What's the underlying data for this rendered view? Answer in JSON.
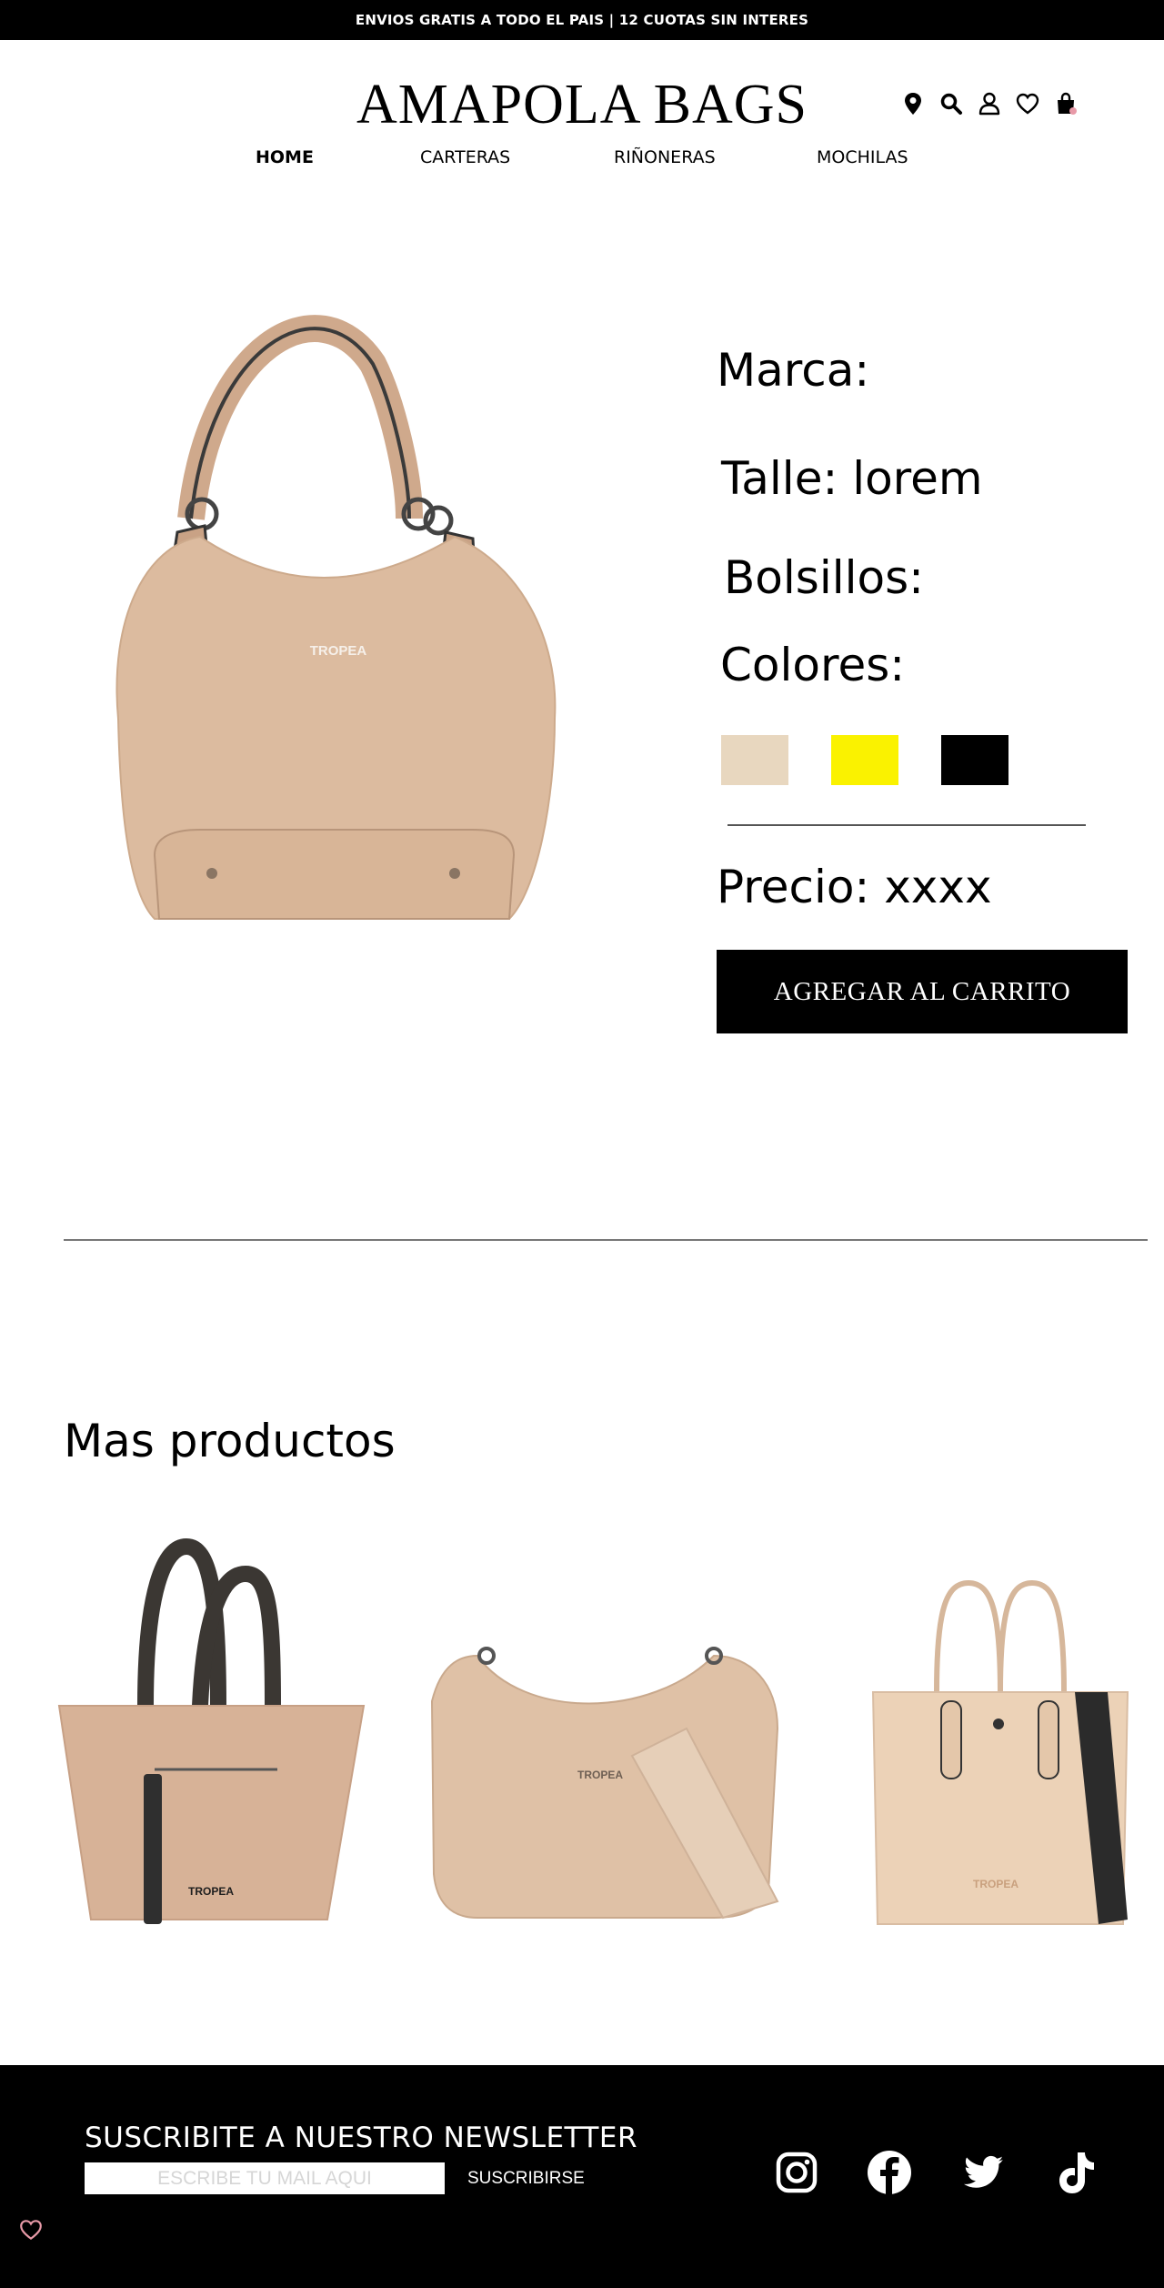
{
  "topbar": {
    "text": "ENVIOS GRATIS A TODO EL PAIS | 12 CUOTAS SIN INTERES"
  },
  "brand": {
    "logo_text": "AMAPOLA BAGS"
  },
  "header_icons": [
    "location-icon",
    "search-icon",
    "user-icon",
    "heart-icon",
    "shopping-bag-icon"
  ],
  "nav": {
    "items": [
      {
        "label": "HOME",
        "active": true
      },
      {
        "label": "CARTERAS",
        "active": false
      },
      {
        "label": "RIÑONERAS",
        "active": false
      },
      {
        "label": "MOCHILAS",
        "active": false
      }
    ]
  },
  "product": {
    "marca": "Marca:",
    "talle": "Talle: lorem",
    "bolsillos": "Bolsillos:",
    "colores": "Colores:",
    "color_swatches": [
      "#e8d7bf",
      "#faf200",
      "#000000"
    ],
    "precio": "Precio: xxxx",
    "add_to_cart": "AGREGAR AL CARRITO",
    "image_brand": "TROPEA"
  },
  "more": {
    "title": "Mas productos",
    "items": [
      {
        "brand_label": "TROPEA"
      },
      {
        "brand_label": "TROPEA"
      },
      {
        "brand_label": "TROPEA"
      }
    ]
  },
  "footer": {
    "newsletter_title": "SUSCRIBITE A NUESTRO NEWSLETTER",
    "email_placeholder": "ESCRIBE TU MAIL AQUI",
    "subscribe_label": "SUSCRIBIRSE",
    "social_icons": [
      "instagram-icon",
      "facebook-icon",
      "twitter-icon",
      "tiktok-icon"
    ]
  },
  "colors": {
    "black": "#000000",
    "bag_beige": "#dcb89a",
    "accent_pink": "#e89aa8"
  }
}
